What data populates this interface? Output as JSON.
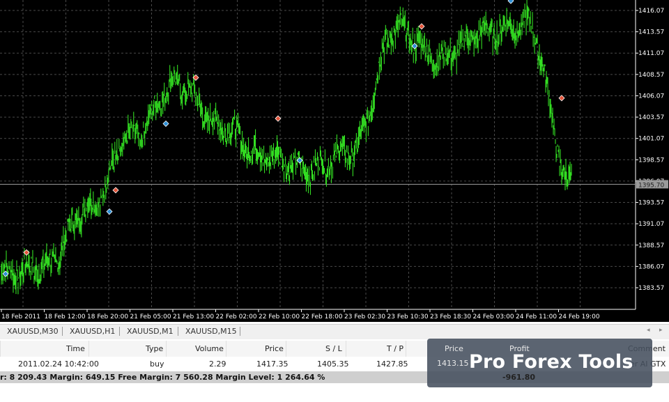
{
  "chart": {
    "symbol": "XAUUSD",
    "current_price_label": "1395.70",
    "y_ticks": [
      "1416.07",
      "1413.57",
      "1411.07",
      "1408.57",
      "1406.07",
      "1403.57",
      "1401.07",
      "1398.57",
      "1396.07",
      "1393.57",
      "1391.07",
      "1388.57",
      "1386.07",
      "1383.57"
    ],
    "x_ticks": [
      "18 Feb 2011",
      "18 Feb 12:00",
      "18 Feb 20:00",
      "21 Feb 05:00",
      "21 Feb 13:00",
      "22 Feb 02:00",
      "22 Feb 10:00",
      "22 Feb 18:00",
      "23 Feb 02:30",
      "23 Feb 10:30",
      "23 Feb 18:30",
      "24 Feb 03:00",
      "24 Feb 11:00",
      "24 Feb 19:00"
    ],
    "colors": {
      "background": "#000000",
      "candle": "#33dd22",
      "grid": "#4a4a4a",
      "buy_marker": "#2e8fd6",
      "sell_marker": "#e2543a"
    }
  },
  "chart_data": {
    "type": "line",
    "title": "",
    "xlabel": "",
    "ylabel": "",
    "ylim": [
      1381.5,
      1417.2
    ],
    "grid": true,
    "series": [
      {
        "x": [
          "18 Feb 2011",
          "18 Feb 12:00",
          "18 Feb 20:00",
          "21 Feb 05:00",
          "21 Feb 13:00",
          "22 Feb 02:00",
          "22 Feb 10:00",
          "22 Feb 18:00",
          "23 Feb 02:30",
          "23 Feb 10:30",
          "23 Feb 18:30",
          "24 Feb 03:00",
          "24 Feb 11:00",
          "24 Feb 19:00"
        ],
        "values": [
          1385.2,
          1386.0,
          1393.0,
          1401.5,
          1407.5,
          1402.5,
          1399.0,
          1397.5,
          1399.5,
          1414.0,
          1410.5,
          1413.5,
          1414.5,
          1395.7
        ]
      }
    ]
  },
  "tabs": [
    "XAUUSD,M30",
    "XAUUSD,H1",
    "XAUUSD,M1",
    "XAUUSD,M15"
  ],
  "table": {
    "headers": {
      "time": "Time",
      "type": "Type",
      "volume": "Volume",
      "price": "Price",
      "sl": "S / L",
      "tp": "T / P",
      "price2": "Price",
      "profit": "Profit",
      "comment": "Comment"
    },
    "row": {
      "time": "2011.02.24 10:42:00",
      "type": "buy",
      "volume": "2.29",
      "price": "1417.35",
      "sl": "1405.35",
      "tp": "1427.85",
      "price2": "1413.15",
      "comment_partial": "er AI GTX"
    },
    "summary": "r: 8 209.43  Margin: 649.15  Free Margin: 7 560.28  Margin Level: 1 264.64 %",
    "total_profit": "-961.80"
  },
  "watermark": {
    "text": "Pro Forex Tools"
  }
}
